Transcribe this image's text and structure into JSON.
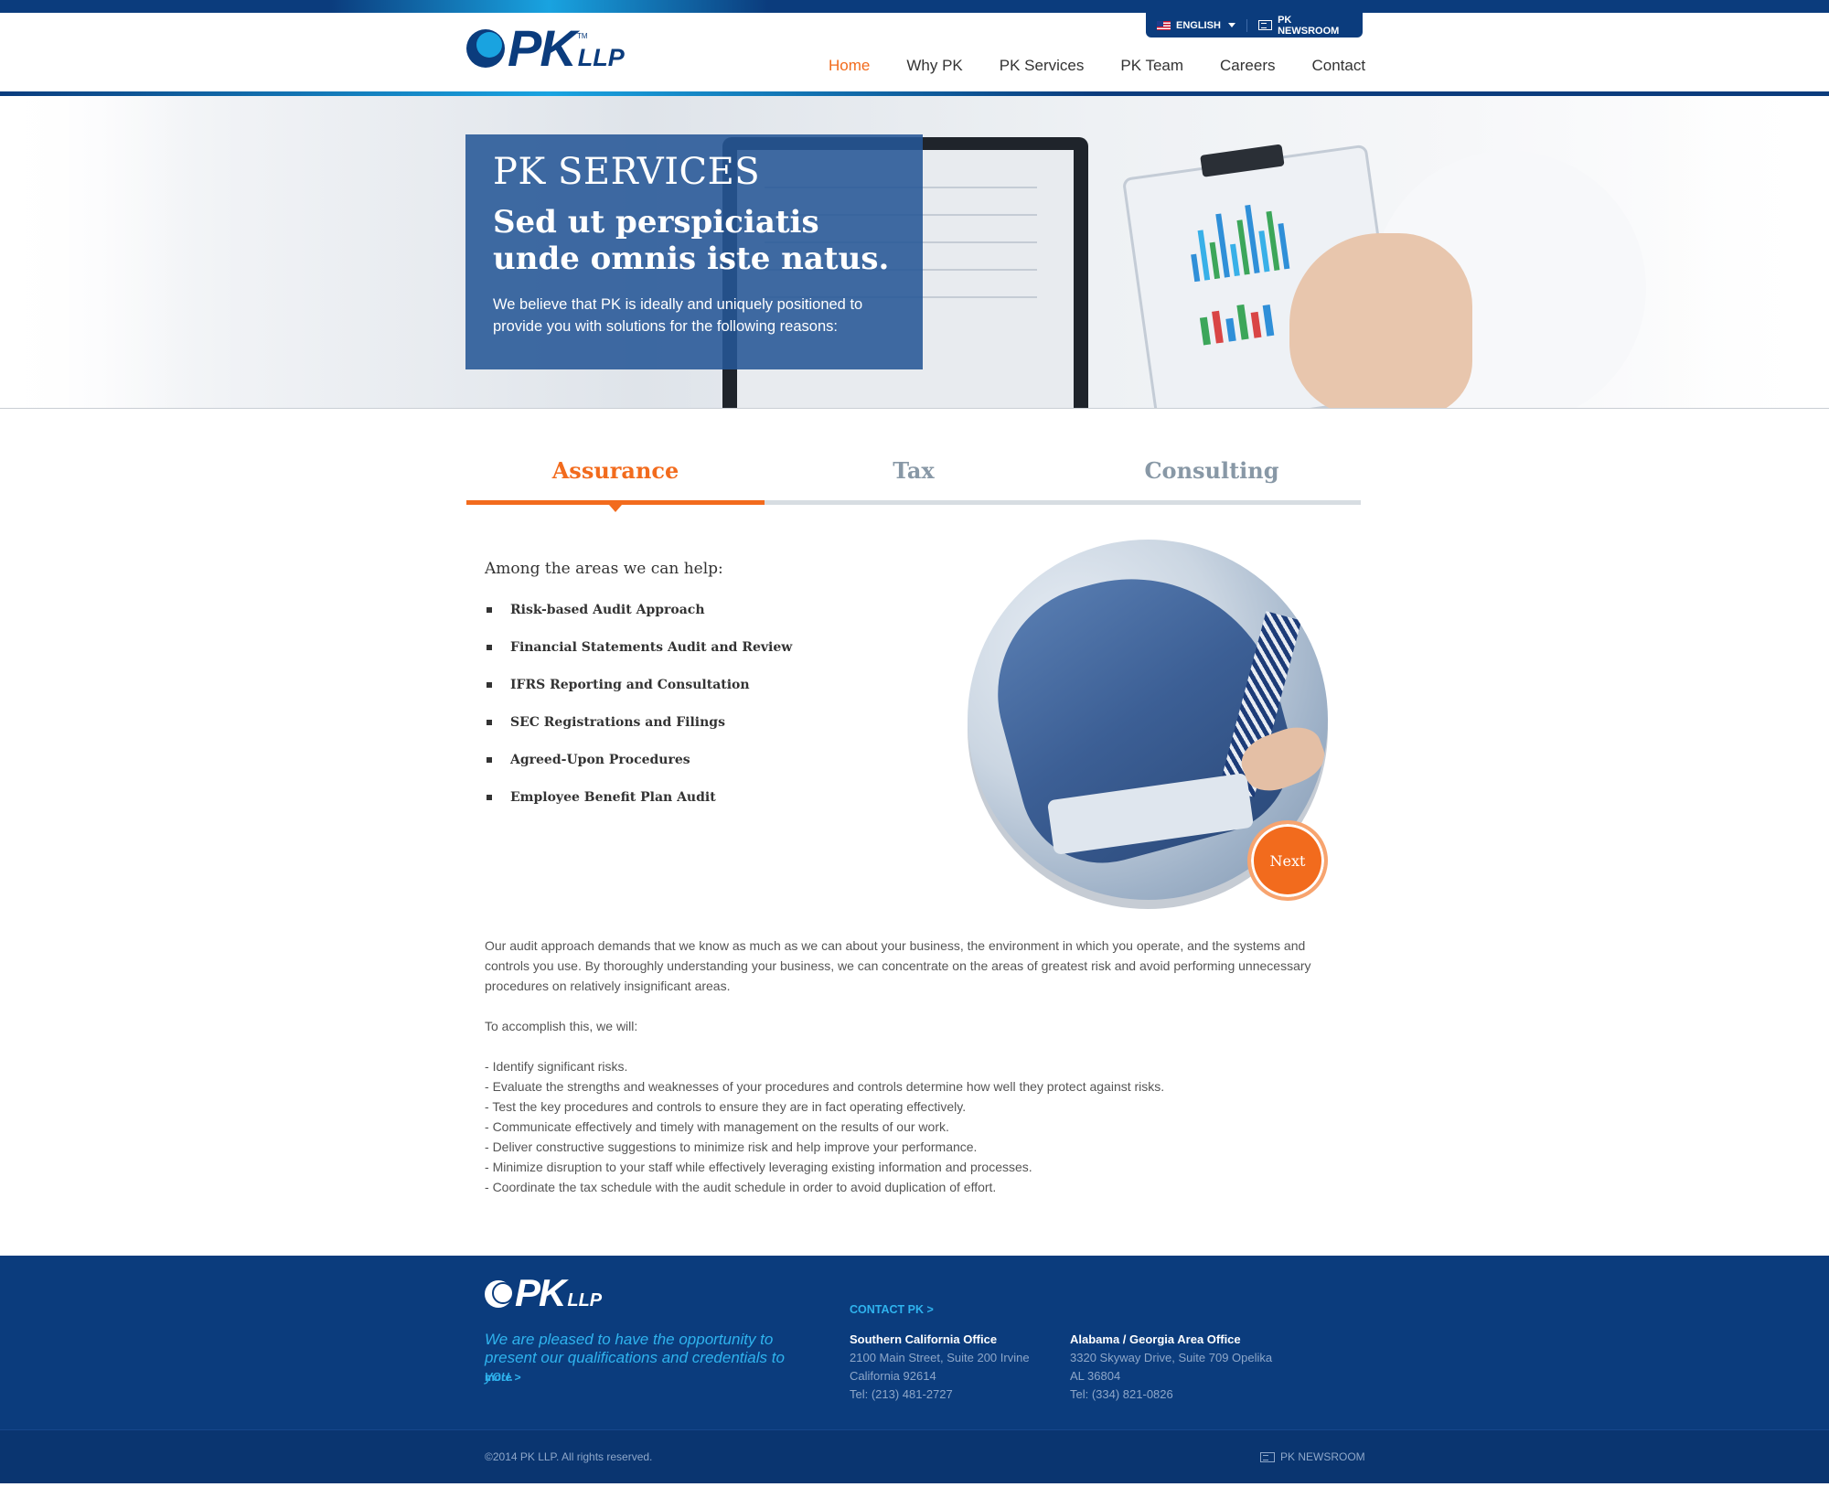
{
  "header": {
    "logo_text": "PK",
    "logo_suffix": "LLP",
    "logo_tm": "TM",
    "language": "ENGLISH",
    "newsroom": "PK NEWSROOM",
    "nav": [
      {
        "label": "Home",
        "active": true
      },
      {
        "label": "Why PK",
        "active": false
      },
      {
        "label": "PK Services",
        "active": false
      },
      {
        "label": "PK Team",
        "active": false
      },
      {
        "label": "Careers",
        "active": false
      },
      {
        "label": "Contact",
        "active": false
      }
    ]
  },
  "hero": {
    "kicker": "PK SERVICES",
    "title": "Sed ut perspiciatis unde omnis iste natus.",
    "text": "We believe that PK is ideally and uniquely positioned to provide you with solutions for the following reasons:"
  },
  "tabs": [
    {
      "label": "Assurance",
      "active": true
    },
    {
      "label": "Tax",
      "active": false
    },
    {
      "label": "Consulting",
      "active": false
    }
  ],
  "assurance": {
    "heading": "Among the areas we can help:",
    "areas": [
      "Risk-based Audit Approach",
      "Financial Statements Audit and Review",
      "IFRS Reporting and Consultation",
      "SEC Registrations and Filings",
      "Agreed-Upon Procedures",
      "Employee Benefit Plan Audit"
    ],
    "next_label": "Next",
    "paragraph": "Our audit approach demands that we know as much as we can about your business, the environment in which you operate, and the systems and controls you use. By thoroughly understanding your business, we can concentrate on the areas of greatest risk and avoid performing unnecessary procedures on relatively insignificant areas.",
    "lead_in": "To accomplish this, we will:",
    "bullets": [
      "Identify significant risks.",
      "Evaluate the strengths and weaknesses of your procedures and controls determine how well they protect against risks.",
      "Test the key procedures and controls to ensure they are in fact operating effectively.",
      "Communicate effectively and timely with management on the results of our work.",
      "Deliver constructive suggestions to minimize risk and help improve your performance.",
      "Minimize disruption to your staff while effectively leveraging existing information and processes.",
      "Coordinate the tax schedule with the audit schedule in order to avoid duplication of effort."
    ]
  },
  "footer": {
    "tagline": "We are pleased to have the opportunity to present our qualifications and credentials to you.",
    "more": "more >",
    "contact_link": "CONTACT PK >",
    "offices": [
      {
        "title": "Southern California Office",
        "line1": "2100 Main Street, Suite 200 Irvine",
        "line2": "California 92614",
        "tel": "Tel: (213) 481-2727"
      },
      {
        "title": "Alabama / Georgia Area Office",
        "line1": "3320 Skyway Drive, Suite 709 Opelika",
        "line2": "AL 36804",
        "tel": "Tel: (334) 821-0826"
      }
    ],
    "copyright": "©2014 PK LLP. All rights reserved.",
    "newsroom": "PK NEWSROOM"
  },
  "colors": {
    "brand_blue": "#0b3c7d",
    "accent_orange": "#f26b1d",
    "light_blue": "#19a3e0"
  }
}
